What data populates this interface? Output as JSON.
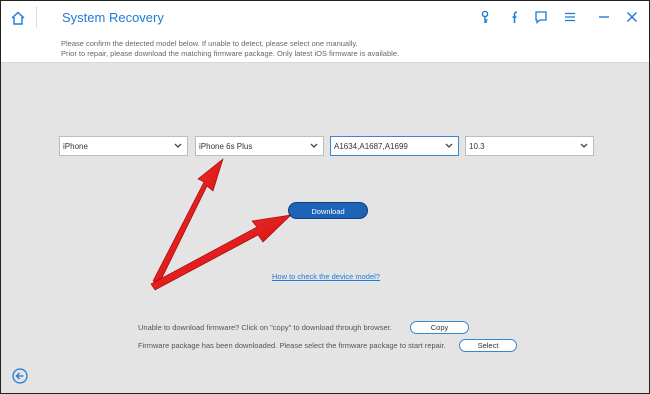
{
  "header": {
    "title": "System Recovery",
    "icons": [
      "home-icon",
      "key-icon",
      "facebook-icon",
      "feedback-icon",
      "menu-icon",
      "minimize-icon",
      "close-icon"
    ]
  },
  "notice": {
    "line1": "Please confirm the detected model below. If unable to detect, please select one manually.",
    "line2": "Prior to repair, please download the matching firmware package. Only latest iOS firmware is available."
  },
  "selectors": {
    "device": "iPhone",
    "model": "iPhone 6s Plus",
    "model_number": "A1634,A1687,A1699",
    "ios_version": "10.3"
  },
  "download_label": "Download",
  "help_link": "How to check the device model?",
  "footer": {
    "copy_msg": "Unable to download firmware? Click on \"copy\" to download through browser.",
    "copy_label": "Copy",
    "select_msg": "Firmware package has been downloaded. Please select the firmware package to start repair.",
    "select_label": "Select"
  },
  "colors": {
    "accent": "#1e7bd6",
    "button": "#1d63b7",
    "arrow": "#e01010"
  }
}
